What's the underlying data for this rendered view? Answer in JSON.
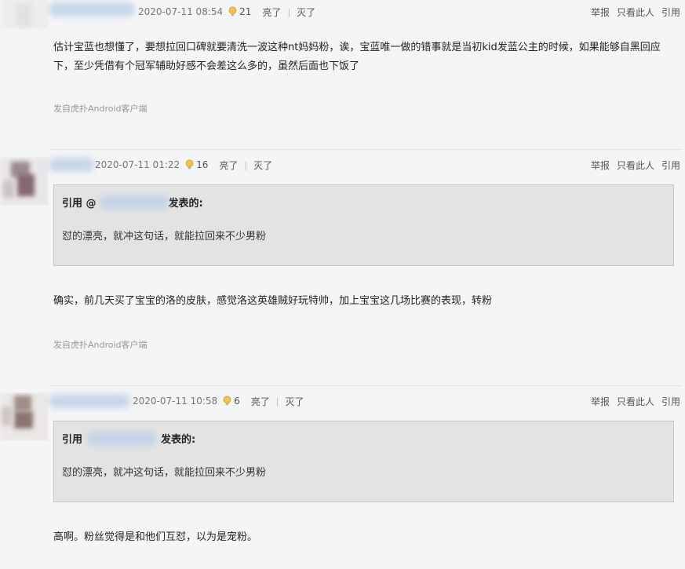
{
  "actions": {
    "report": "举报",
    "only_this": "只看此人",
    "quote": "引用"
  },
  "labels": {
    "like": "亮了",
    "dislike": "灭了"
  },
  "posts": [
    {
      "time": "2020-07-11 08:54",
      "lights": "21",
      "content": "估计宝蓝也想懂了，要想拉回口碑就要清洗一波这种nt妈妈粉，诶，宝蓝唯一做的错事就是当初kid发蓝公主的时候，如果能够自黑回应下，至少凭借有个冠军辅助好感不会差这么多的，虽然后面也下饭了",
      "source": "发自虎扑Android客户端"
    },
    {
      "time": "2020-07-11 01:22",
      "lights": "16",
      "quote_prefix": "引用 @",
      "quote_suffix": "发表的:",
      "quote_text": "怼的漂亮，就冲这句话，就能拉回来不少男粉",
      "content": "确实，前几天买了宝宝的洛的皮肤，感觉洛这英雄贼好玩特帅，加上宝宝这几场比赛的表现，转粉",
      "source": "发自虎扑Android客户端"
    },
    {
      "time": "2020-07-11 10:58",
      "lights": "6",
      "quote_prefix": "引用",
      "quote_suffix": "发表的:",
      "quote_text": "怼的漂亮，就冲这句话，就能拉回来不少男粉",
      "content": "高啊。粉丝觉得是和他们互怼，以为是宠粉。"
    }
  ]
}
